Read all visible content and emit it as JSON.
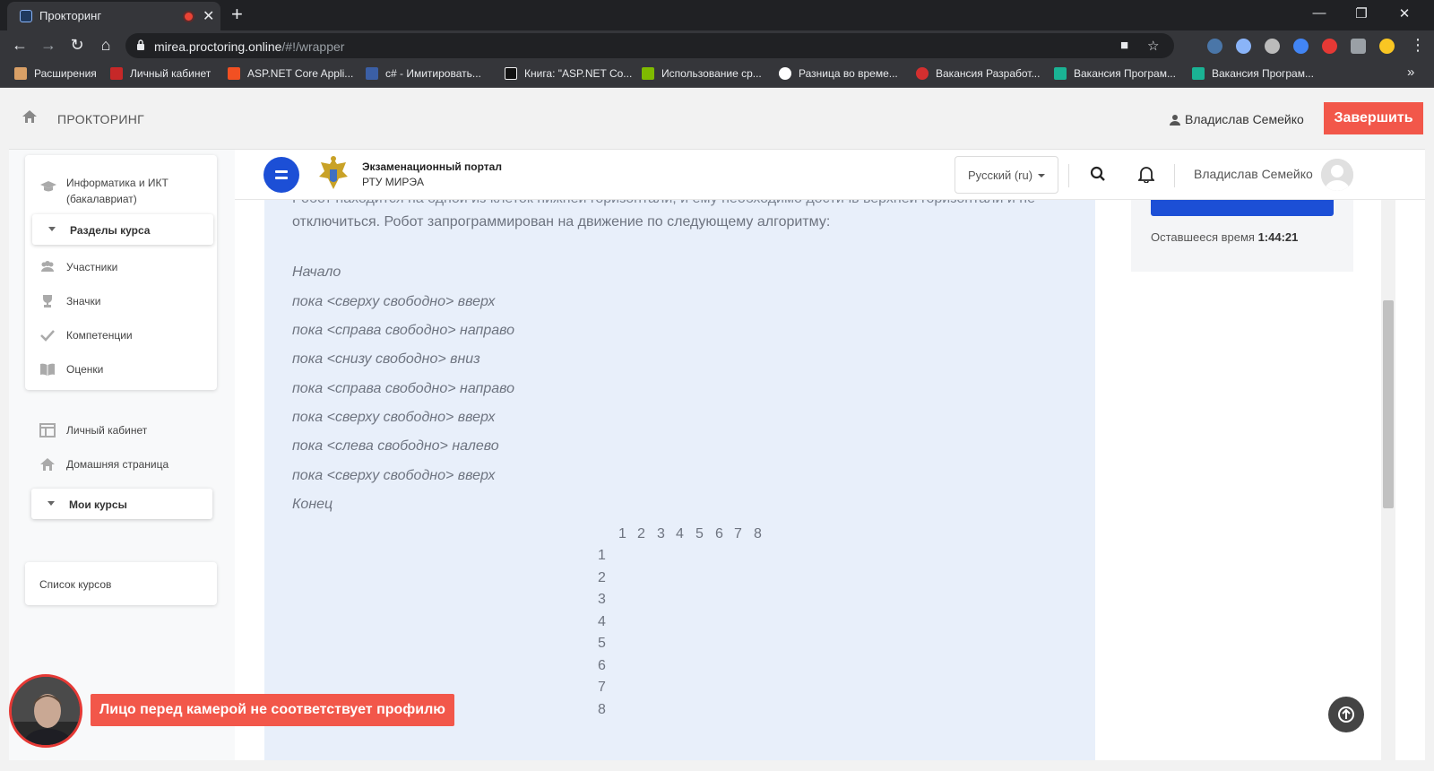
{
  "browser": {
    "tab_title": "Прокторинг",
    "url_host": "mirea.proctoring.online",
    "url_path": "/#!/wrapper",
    "bookmarks": [
      {
        "label": "Расширения"
      },
      {
        "label": "Личный кабинет"
      },
      {
        "label": "ASP.NET Core Appli..."
      },
      {
        "label": "c# - Имитировать..."
      },
      {
        "label": "Книга: \"ASP.NET Co..."
      },
      {
        "label": "Использование ср..."
      },
      {
        "label": "Разница во време..."
      },
      {
        "label": "Вакансия Разработ..."
      },
      {
        "label": "Вакансия Програм..."
      },
      {
        "label": "Вакансия Програм..."
      }
    ],
    "more_bookmarks": "»"
  },
  "proctor": {
    "brand": "ПРОКТОРИНГ",
    "user_name": "Владислав Семейко",
    "finish_label": "Завершить"
  },
  "drawer": {
    "course_name": "Информатика и ИКТ (бакалавриат)",
    "sections_label": "Разделы курса",
    "course_items": [
      {
        "label": "Участники"
      },
      {
        "label": "Значки"
      },
      {
        "label": "Компетенции"
      },
      {
        "label": "Оценки"
      }
    ],
    "personal_items": [
      {
        "label": "Личный кабинет"
      },
      {
        "label": "Домашняя страница"
      }
    ],
    "my_courses_label": "Мои курсы",
    "course_list_label": "Список курсов"
  },
  "header": {
    "portal_title": "Экзаменационный портал",
    "portal_subtitle": "РТУ МИРЭА",
    "language": "Русский (ru)",
    "user_name": "Владислав Семейко"
  },
  "question": {
    "clipped_line": "Робот находится на одной из клеток нижней горизонтали, и ему необходимо достичь верхней горизонтали и не",
    "intro_line": "отключиться. Робот запрограммирован на движение по следующему алгоритму:",
    "algorithm": [
      "Начало",
      "пока <сверху свободно> вверх",
      "пока <справа свободно> направо",
      "пока <снизу свободно> вниз",
      "пока <справа свободно> направо",
      "пока <сверху свободно> вверх",
      "пока <слева свободно> налево",
      "пока <сверху свободно> вверх",
      "Конец"
    ],
    "grid_columns": [
      "1",
      "2",
      "3",
      "4",
      "5",
      "6",
      "7",
      "8"
    ],
    "grid_rows": [
      "1",
      "2",
      "3",
      "4",
      "5",
      "6",
      "7",
      "8"
    ]
  },
  "timer": {
    "label": "Оставшееся время",
    "value": "1:44:21"
  },
  "alert": {
    "message": "Лицо перед камерой не соответствует профилю"
  }
}
